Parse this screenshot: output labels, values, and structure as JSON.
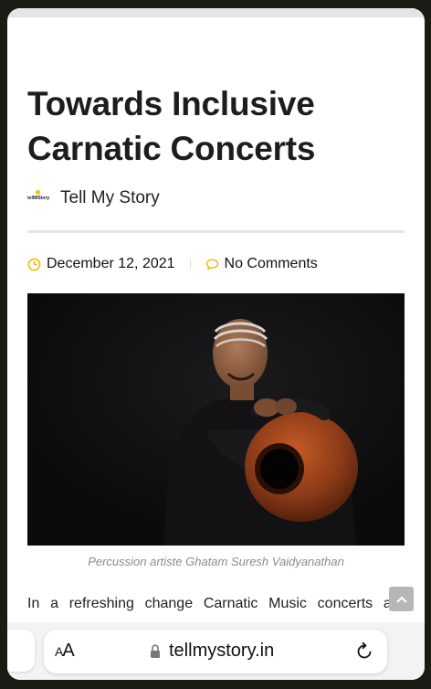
{
  "article": {
    "title": "Towards Inclusive Carnatic Concerts",
    "author": {
      "logo_text": "tellMStory",
      "name": "Tell My Story"
    },
    "date": "December 12, 2021",
    "comments": "No Comments",
    "image_caption": "Percussion artiste Ghatam Suresh Vaidyanathan",
    "body_start": "In a refreshing change Carnatic Music concerts are"
  },
  "browser": {
    "text_size_label": "AA",
    "url": "tellmystory.in"
  },
  "icons": {
    "date": "clock-icon",
    "comments": "speech-bubble-icon",
    "scroll": "chevron-up-icon",
    "lock": "lock-icon",
    "reload": "reload-icon"
  },
  "colors": {
    "meta_icon": "#f2b600",
    "title": "#1d1d1d",
    "caption": "#8b8b8b"
  }
}
